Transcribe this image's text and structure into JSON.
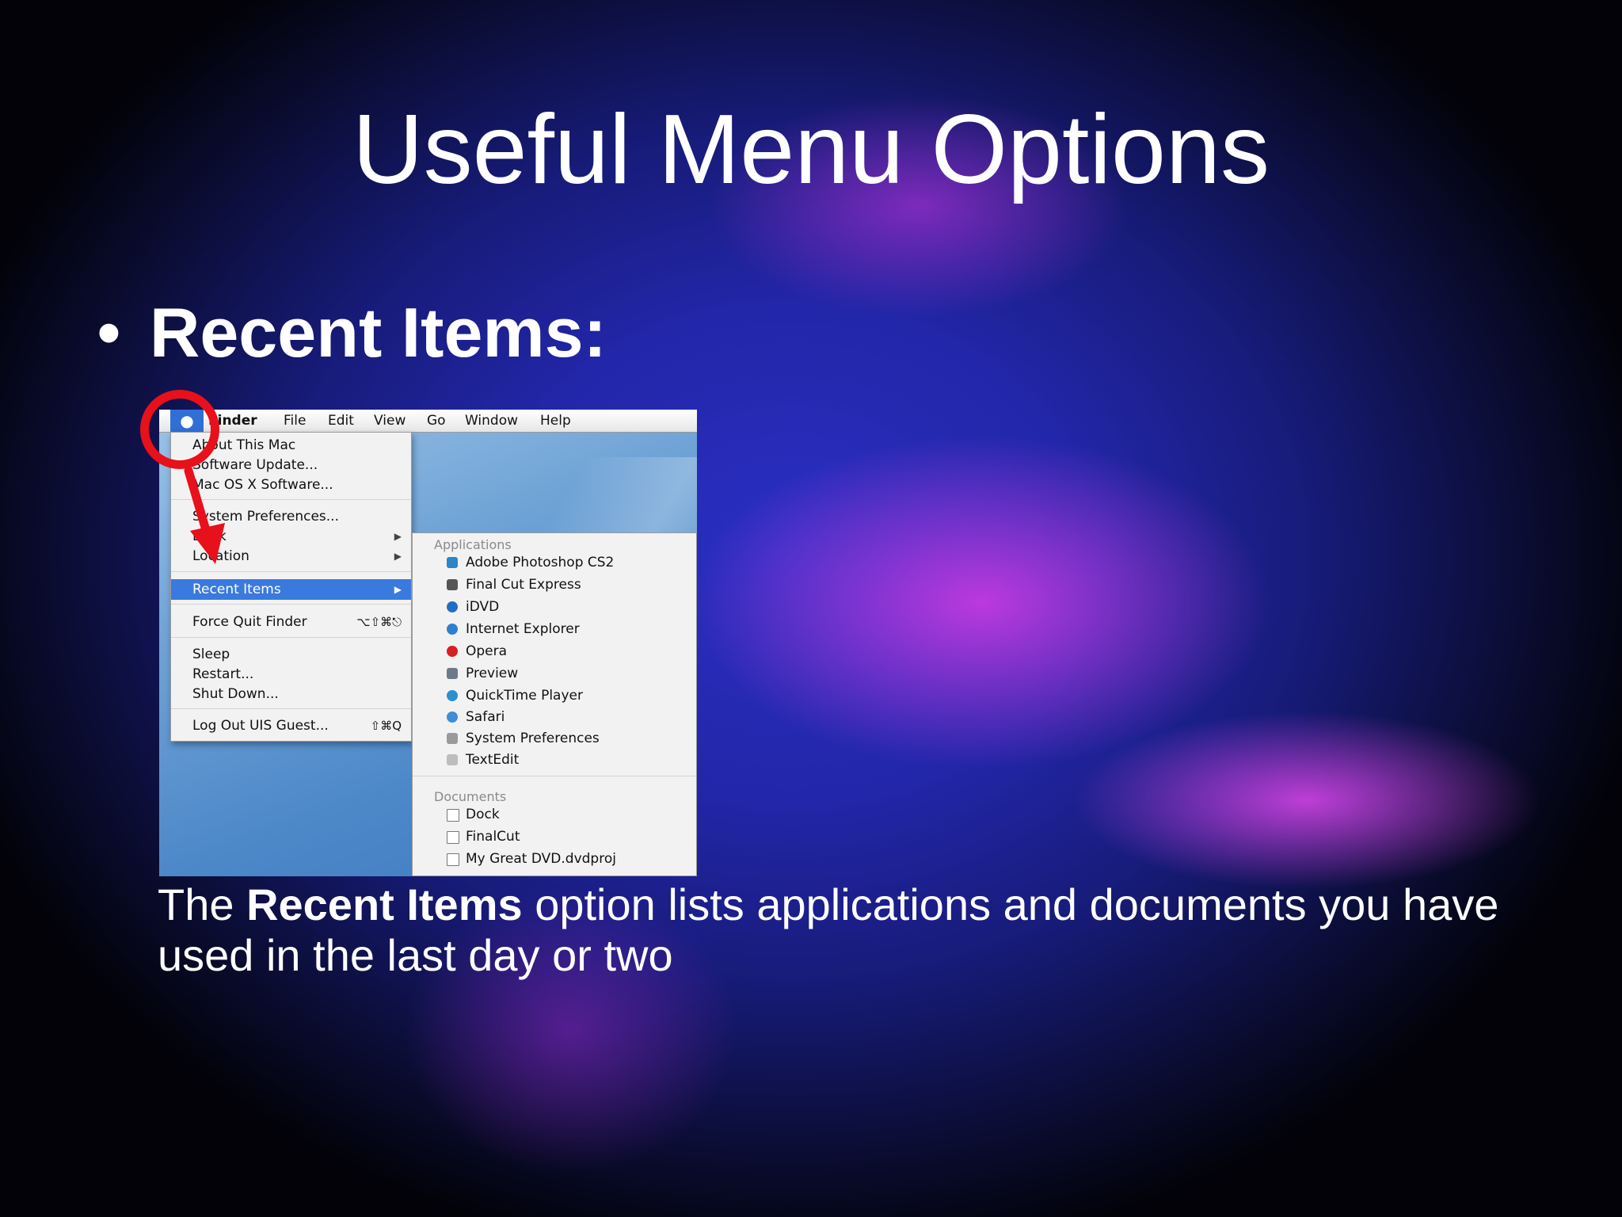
{
  "slide": {
    "title": "Useful Menu Options",
    "bullet": "Recent Items:",
    "caption": {
      "prefix": "The ",
      "bold": "Recent Items",
      "suffix": " option lists applications and documents you have used in the last day or two"
    }
  },
  "menubar": {
    "apple": "",
    "items": [
      "Finder",
      "File",
      "Edit",
      "View",
      "Go",
      "Window",
      "Help"
    ]
  },
  "apple_menu": {
    "items": [
      {
        "label": "About This Mac"
      },
      {
        "label": "Software Update..."
      },
      {
        "label": "Mac OS X Software..."
      },
      {
        "label": "System Preferences..."
      },
      {
        "label": "Dock",
        "submenu": "▶"
      },
      {
        "label": "Location",
        "submenu": "▶"
      },
      {
        "label": "Recent Items",
        "submenu": "▶"
      },
      {
        "label": "Force Quit Finder",
        "shortcut": "⌥⇧⌘⎋"
      },
      {
        "label": "Sleep"
      },
      {
        "label": "Restart..."
      },
      {
        "label": "Shut Down..."
      },
      {
        "label": "Log Out UIS Guest...",
        "shortcut": "⇧⌘Q"
      }
    ]
  },
  "recent_items": {
    "applications_header": "Applications",
    "applications": [
      {
        "label": "Adobe Photoshop CS2",
        "icon": "photoshop-icon",
        "color": "#2a86c9"
      },
      {
        "label": "Final Cut Express",
        "icon": "final-cut-icon",
        "color": "#555555"
      },
      {
        "label": "iDVD",
        "icon": "idvd-icon",
        "color": "#1f6fc4"
      },
      {
        "label": "Internet Explorer",
        "icon": "internet-explorer-icon",
        "color": "#2f7fd0"
      },
      {
        "label": "Opera",
        "icon": "opera-icon",
        "color": "#d7201f"
      },
      {
        "label": "Preview",
        "icon": "preview-icon",
        "color": "#6d7a88"
      },
      {
        "label": "QuickTime Player",
        "icon": "quicktime-icon",
        "color": "#2a8fd0"
      },
      {
        "label": "Safari",
        "icon": "safari-icon",
        "color": "#3d8ed6"
      },
      {
        "label": "System Preferences",
        "icon": "system-preferences-icon",
        "color": "#9a9a9a"
      },
      {
        "label": "TextEdit",
        "icon": "textedit-icon",
        "color": "#bdbdbd"
      }
    ],
    "documents_header": "Documents",
    "documents": [
      {
        "label": "Dock",
        "icon": "document-icon"
      },
      {
        "label": "FinalCut",
        "icon": "document-icon"
      },
      {
        "label": "My Great DVD.dvdproj",
        "icon": "dvd-project-icon"
      }
    ]
  },
  "colors": {
    "annotation_red": "#e8101a",
    "menu_highlight": "#3a79de"
  }
}
